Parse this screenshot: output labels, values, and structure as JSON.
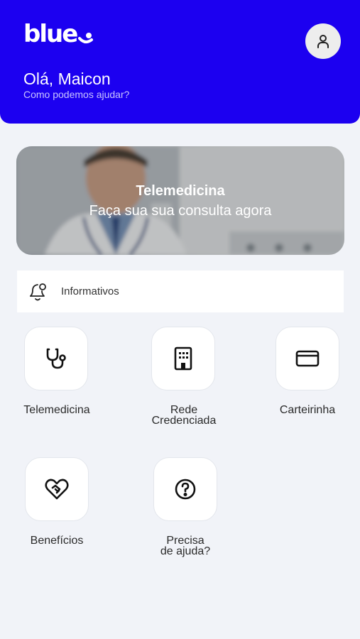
{
  "header": {
    "logo_text": "blue",
    "greeting": "Olá, Maicon",
    "subtitle": "Como podemos ajudar?",
    "brand_color": "#1c00f0",
    "avatar_icon": "user-icon"
  },
  "banner": {
    "title": "Telemedicina",
    "subtitle": "Faça sua sua consulta agora"
  },
  "info_bar": {
    "label": "Informativos",
    "icon": "bell-icon"
  },
  "menu": [
    {
      "label_line1": "Telemedicina",
      "label_line2": "",
      "icon": "stethoscope-icon"
    },
    {
      "label_line1": "Rede",
      "label_line2": "Credenciada",
      "icon": "building-icon"
    },
    {
      "label_line1": "Carteirinha",
      "label_line2": "",
      "icon": "card-icon"
    },
    {
      "label_line1": "Benefícios",
      "label_line2": "",
      "icon": "heart-handshake-icon"
    },
    {
      "label_line1": "Precisa",
      "label_line2": "de ajuda?",
      "icon": "help-icon"
    }
  ]
}
